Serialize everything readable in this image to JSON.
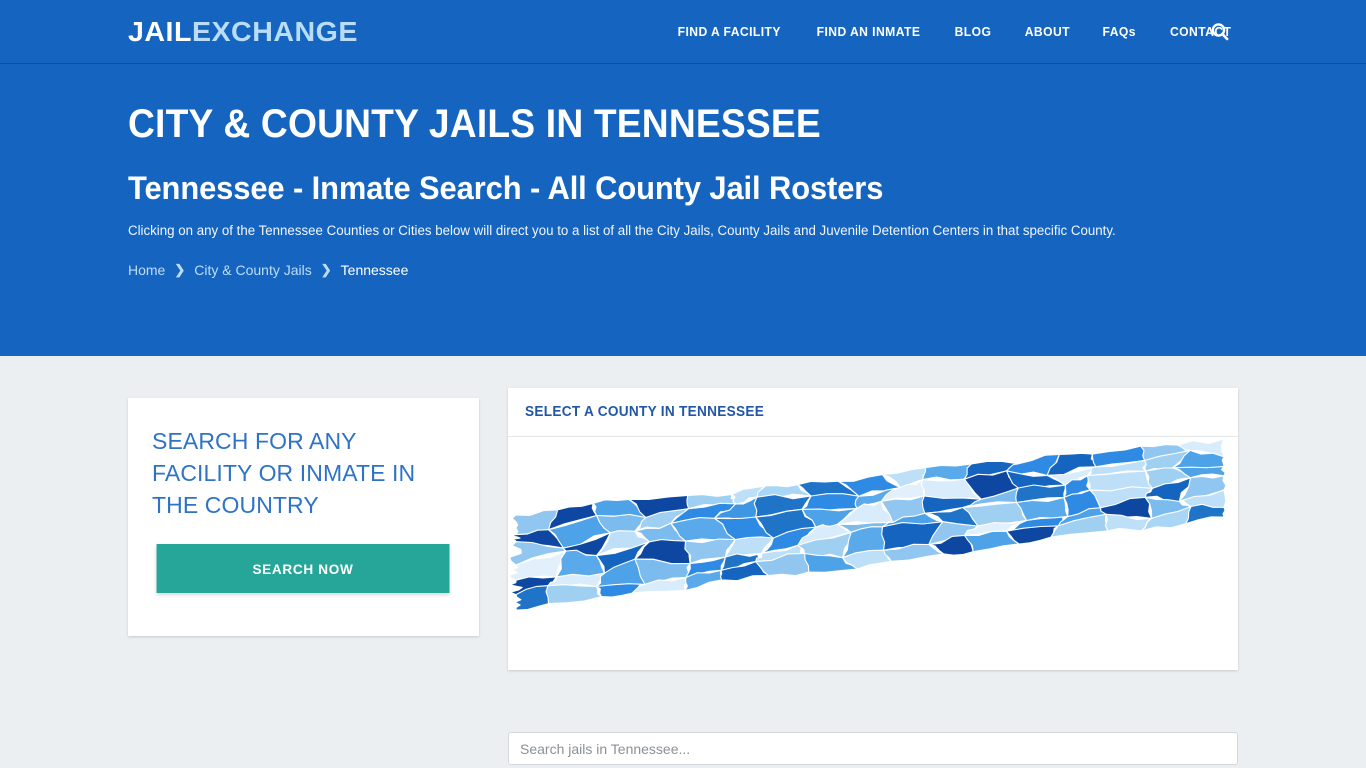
{
  "brand": {
    "part1": "JAIL",
    "part2": "EXCHANGE"
  },
  "nav": {
    "items": [
      {
        "label": "FIND A FACILITY",
        "name": "nav-find-a-facility"
      },
      {
        "label": "FIND AN INMATE",
        "name": "nav-find-an-inmate"
      },
      {
        "label": "BLOG",
        "name": "nav-blog"
      },
      {
        "label": "ABOUT",
        "name": "nav-about"
      },
      {
        "label": "FAQs",
        "name": "nav-faqs"
      },
      {
        "label": "CONTACT",
        "name": "nav-contact"
      }
    ],
    "search_icon": "search-icon"
  },
  "hero": {
    "title": "CITY & COUNTY JAILS IN TENNESSEE",
    "subtitle": "Tennessee - Inmate Search - All County Jail Rosters",
    "description": "Clicking on any of the Tennessee Counties or Cities below will direct you to a list of all the City Jails, County Jails and Juvenile Detention Centers in that specific County.",
    "breadcrumb": [
      {
        "label": "Home",
        "current": false
      },
      {
        "label": "City & County Jails",
        "current": false
      },
      {
        "label": "Tennessee",
        "current": true
      }
    ],
    "breadcrumb_separator": "❯"
  },
  "search_card": {
    "heading": "SEARCH FOR ANY FACILITY OR INMATE IN THE COUNTRY",
    "button_label": "SEARCH NOW"
  },
  "map_panel": {
    "title": "SELECT A COUNTY IN TENNESSEE",
    "search_placeholder": "Search jails in Tennessee...",
    "search_value": ""
  },
  "colors": {
    "brand_blue": "#1565c0",
    "hero_blue": "#1565c0",
    "body_gray": "#eceff1",
    "accent_teal": "#26a699",
    "link_blue": "#2f73c7",
    "panel_title_blue": "#2257a8",
    "breadcrumb_link": "#bfdcf7"
  },
  "map": {
    "region": "Tennessee",
    "shape_fills": [
      "#90c6ef",
      "#0d47a1",
      "#4ea2e8",
      "#0d47a1",
      "#9fd0f2",
      "#bedff8",
      "#a9d6f4",
      "#1f74c8",
      "#2e8ae2",
      "#bedff8",
      "#5aa9ea",
      "#1565c0",
      "#2e8ae2",
      "#1565c0",
      "#2e8ae2",
      "#90c6ef",
      "#d8ecfb",
      "#0d47a1",
      "#4ea2e8",
      "#7bbbee",
      "#9fd0f2",
      "#2e8ae2",
      "#3f97e4",
      "#1f74c8",
      "#2e8ae2",
      "#5aa9ea",
      "#e2f0fc",
      "#d8ecfb",
      "#0d47a1",
      "#1565c0",
      "#d8ecfb",
      "#bedff8",
      "#9fd0f2",
      "#4ea2e8",
      "#90c6ef",
      "#0d47a1",
      "#bedff8",
      "#7bbbee",
      "#5aa9ea",
      "#2e8ae2",
      "#1f74c8",
      "#4ea2e8",
      "#d8ecfb",
      "#90c6ef",
      "#1565c0",
      "#7bbbee",
      "#1f74c8",
      "#2e8ae2",
      "#bedff8",
      "#9fd0f2",
      "#4ea2e8",
      "#e2f0fc",
      "#5aa9ea",
      "#1565c0",
      "#0d47a1",
      "#90c6ef",
      "#bedff8",
      "#2e8ae2",
      "#d8ecfb",
      "#7bbbee",
      "#4ea2e8",
      "#1f74c8",
      "#9fd0f2",
      "#5aa9ea",
      "#2e8ae2",
      "#bedff8",
      "#1565c0",
      "#90c6ef",
      "#0d47a1",
      "#d8ecfb",
      "#4ea2e8",
      "#7bbbee",
      "#2e8ae2",
      "#1f74c8",
      "#bedff8",
      "#9fd0f2",
      "#5aa9ea",
      "#1565c0",
      "#90c6ef",
      "#e2f0fc",
      "#2e8ae2",
      "#4ea2e8",
      "#0d47a1",
      "#7bbbee",
      "#bedff8",
      "#1f74c8",
      "#9fd0f2",
      "#2e8ae2",
      "#d8ecfb",
      "#5aa9ea",
      "#1565c0",
      "#90c6ef",
      "#4ea2e8",
      "#bedff8"
    ]
  }
}
